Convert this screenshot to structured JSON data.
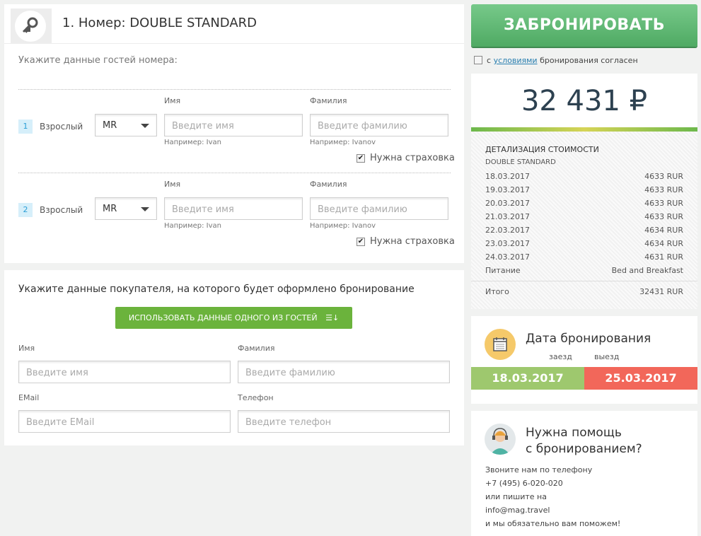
{
  "room": {
    "title": "1. Номер: DOUBLE STANDARD",
    "hint": "Укажите данные гостей номера:",
    "guests": [
      {
        "num": "1",
        "type": "Взрослый",
        "title": "MR",
        "first_label": "Имя",
        "last_label": "Фамилия",
        "first_placeholder": "Введите имя",
        "last_placeholder": "Введите фамилию",
        "first_example": "Например: Ivan",
        "last_example": "Например: Ivanov",
        "insurance_label": "Нужна страховка",
        "insurance_checked": true
      },
      {
        "num": "2",
        "type": "Взрослый",
        "title": "MR",
        "first_label": "Имя",
        "last_label": "Фамилия",
        "first_placeholder": "Введите имя",
        "last_placeholder": "Введите фамилию",
        "first_example": "Например: Ivan",
        "last_example": "Например: Ivanov",
        "insurance_label": "Нужна страховка",
        "insurance_checked": true
      }
    ]
  },
  "buyer": {
    "title": "Укажите данные покупателя, на которого будет оформлено бронирование",
    "use_guest_button": "ИСПОЛЬЗОВАТЬ ДАННЫЕ ОДНОГО ИЗ ГОСТЕЙ",
    "use_guest_icon": "☰↓",
    "first_label": "Имя",
    "last_label": "Фамилия",
    "first_placeholder": "Введите имя",
    "last_placeholder": "Введите фамилию",
    "email_label": "EMail",
    "phone_label": "Телефон",
    "email_placeholder": "Введите EMail",
    "phone_placeholder": "Введите телефон"
  },
  "booking": {
    "book_button": "ЗАБРОНИРОВАТЬ",
    "agree_prefix": "с",
    "agree_link": "условиями",
    "agree_suffix": "бронирования согласен",
    "agree_checked": false
  },
  "price": {
    "total": "32 431 ₽",
    "details_title": "ДЕТАЛИЗАЦИЯ СТОИМОСТИ",
    "room_name": "DOUBLE STANDARD",
    "rows": [
      {
        "date": "18.03.2017",
        "amount": "4633 RUR"
      },
      {
        "date": "19.03.2017",
        "amount": "4633 RUR"
      },
      {
        "date": "20.03.2017",
        "amount": "4633 RUR"
      },
      {
        "date": "21.03.2017",
        "amount": "4633 RUR"
      },
      {
        "date": "22.03.2017",
        "amount": "4634 RUR"
      },
      {
        "date": "23.03.2017",
        "amount": "4634 RUR"
      },
      {
        "date": "24.03.2017",
        "amount": "4631 RUR"
      }
    ],
    "meal_label": "Питание",
    "meal_value": "Bed and Breakfast",
    "total_label": "Итого",
    "total_value": "32431 RUR"
  },
  "dates": {
    "title": "Дата бронирования",
    "checkin_label": "заезд",
    "checkout_label": "выезд",
    "checkin": "18.03.2017",
    "checkout": "25.03.2017"
  },
  "help": {
    "title_line1": "Нужна помощь",
    "title_line2": "с бронированием?",
    "lines": [
      "Звоните нам по телефону",
      "+7 (495) 6-020-020",
      "или пишите на",
      "info@mag.travel",
      "и мы обязательно вам поможем!"
    ]
  },
  "colors": {
    "primary_green": "#6bb33c",
    "checkin_green": "#9ec86e",
    "checkout_red": "#f2675a",
    "price_text": "#2d4150"
  }
}
